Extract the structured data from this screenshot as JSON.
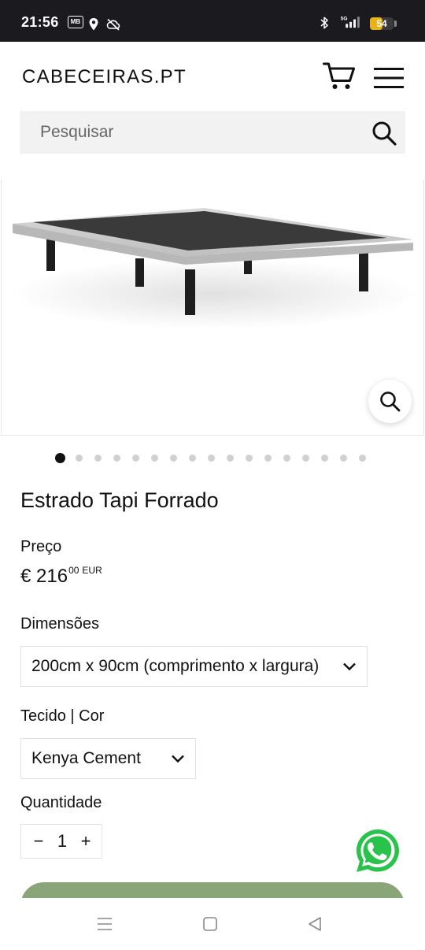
{
  "status_bar": {
    "time": "21:56",
    "mb_badge": "MB",
    "battery": "54",
    "battery_level": 0.54,
    "network": "5G",
    "icons": [
      "mb-icon",
      "location-icon",
      "cloud-off-icon",
      "bluetooth-icon",
      "signal-icon",
      "battery-icon"
    ]
  },
  "header": {
    "logo": "CABECEIRAS.PT",
    "icons": [
      "cart-icon",
      "menu-icon"
    ]
  },
  "search": {
    "placeholder": "Pesquisar"
  },
  "gallery": {
    "image_count": 17,
    "active_index": 0,
    "zoom_icon": "zoom-icon"
  },
  "product": {
    "title": "Estrado Tapi Forrado",
    "price_label": "Preço",
    "price_main": "€ 216",
    "price_cents": "00",
    "price_currency": "EUR",
    "dimensions_label": "Dimensões",
    "dimensions_value": "200cm x 90cm (comprimento x largura)",
    "fabric_label": "Tecido | Cor",
    "fabric_value": "Kenya Cement",
    "quantity_label": "Quantidade",
    "quantity_minus": "−",
    "quantity_value": "1",
    "quantity_plus": "+"
  },
  "colors": {
    "status_bar": "#1b1b1f",
    "battery": "#e8b219",
    "search_bg": "#f2f2f2",
    "add_button": "#8aa578",
    "whatsapp": "#29c24a"
  },
  "nav_bar": {
    "icons": [
      "recent-apps-icon",
      "home-icon",
      "back-icon"
    ]
  }
}
